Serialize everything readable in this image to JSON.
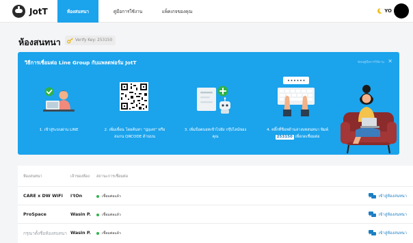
{
  "app": {
    "brand": "JotT"
  },
  "nav": {
    "tabs": [
      {
        "label": "ห้องสนทนา",
        "active": true
      },
      {
        "label": "คู่มือการใช้งาน",
        "active": false
      },
      {
        "label": "แพ็คเกจของคุณ",
        "active": false
      }
    ]
  },
  "user": {
    "initials": "YO"
  },
  "page": {
    "title": "ห้องสนทนา",
    "verify_key": "Verify Key: 253150"
  },
  "guide": {
    "title": "วิธีการเชื่อมต่อ Line Group กับแพลตฟอร์ม JotT",
    "hide_label": "ซ่อนคู่มือการใช้งาน",
    "steps": [
      {
        "line1": "1. เข้าสู่ระบบผ่าน LINE",
        "line2": ""
      },
      {
        "line1": "2. เพิ่มเพื่อน โดยค้นหา \"@jott\" หรือ",
        "line2": "สแกน QRCODE ด้านบน"
      },
      {
        "line1": "3. เพิ่มบ็อตบอทเข้าไปยัง กรุ๊ปไลน์ของ",
        "line2": "คุณ"
      },
      {
        "line1": "4. คลิ๊กที่ช็อทด้านล่างบทสนทนา พิมพ์",
        "line2_key": "253150",
        "line2_rest": " เพื่อกดเชื่อมต่อ"
      }
    ]
  },
  "table": {
    "headers": [
      "ห้องสนทนา",
      "เจ้าของห้อง",
      "สถานะการเชื่อมต่อ"
    ],
    "enter_label": "เข้าสู่ห้องสนทนา",
    "rows": [
      {
        "room": "CARE x DW WiFi",
        "owner": "i'tOn",
        "status": "เชื่อมต่อแล้ว"
      },
      {
        "room": "ProSpace",
        "owner": "Wasin P.",
        "status": "เชื่อมต่อแล้ว"
      },
      {
        "room": "กรุณาตั้งชื่อห้องสนทนา",
        "owner": "Wasin P.",
        "status": "เชื่อมต่อแล้ว"
      }
    ]
  },
  "colors": {
    "accent": "#1ba3ec",
    "link": "#1b7fc4",
    "connected": "#2fb34a"
  }
}
